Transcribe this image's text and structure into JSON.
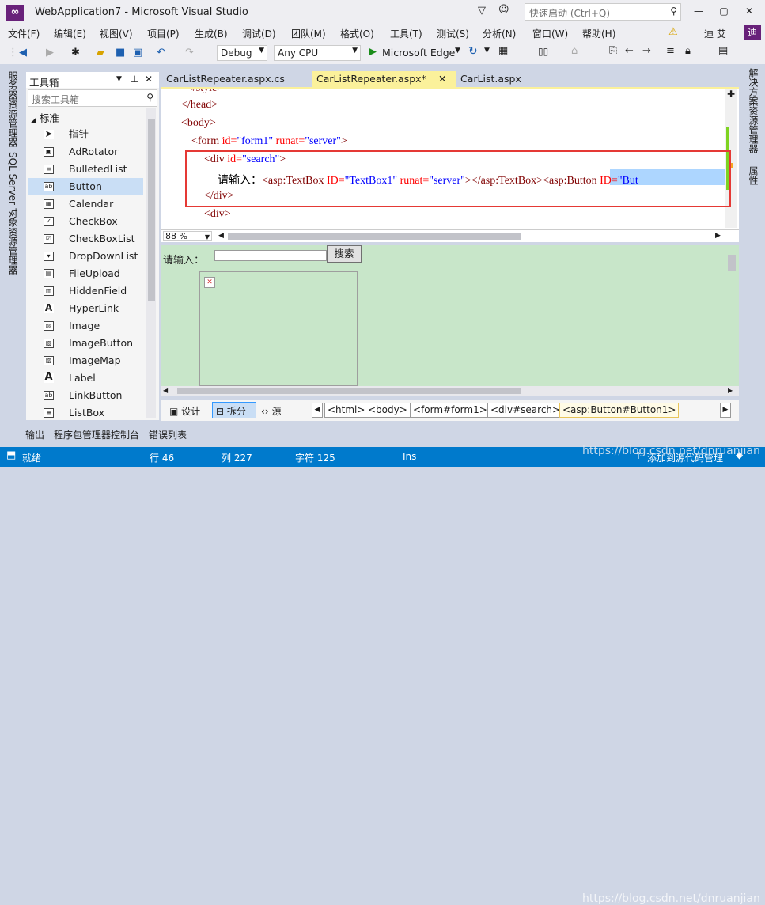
{
  "window": {
    "title": "WebApplication7 - Microsoft Visual Studio",
    "quick_launch_placeholder": "快速启动 (Ctrl+Q)",
    "logo": "vs-logo"
  },
  "menu": [
    "文件(F)",
    "编辑(E)",
    "视图(V)",
    "项目(P)",
    "生成(B)",
    "调试(D)",
    "团队(M)",
    "格式(O)",
    "工具(T)",
    "测试(S)",
    "分析(N)",
    "窗口(W)",
    "帮助(H)"
  ],
  "account": {
    "user": "迪 艾",
    "initial": "迪"
  },
  "toolbar": {
    "config": "Debug",
    "platform": "Any CPU",
    "browser": "Microsoft Edge"
  },
  "left_strip": {
    "server_explorer": "服务器资源管理器",
    "sql_explorer": "SQL Server 对象资源管理器"
  },
  "toolbox": {
    "title": "工具箱",
    "search_placeholder": "搜索工具箱",
    "group": "标准",
    "items": [
      "指针",
      "AdRotator",
      "BulletedList",
      "Button",
      "Calendar",
      "CheckBox",
      "CheckBoxList",
      "DropDownList",
      "FileUpload",
      "HiddenField",
      "HyperLink",
      "Image",
      "ImageButton",
      "ImageMap",
      "Label",
      "LinkButton",
      "ListBox"
    ],
    "selected": "Button"
  },
  "tabs": [
    {
      "label": "CarListRepeater.aspx.cs",
      "active": false
    },
    {
      "label": "CarListRepeater.aspx*",
      "active": true
    },
    {
      "label": "CarList.aspx",
      "active": false
    }
  ],
  "code": {
    "l0": "</style>",
    "l1": "</head>",
    "l2": "<body>",
    "l3_tag": "<form",
    "l3_id_attr": " id=",
    "l3_id_val": "\"form1\"",
    "l3_runat_attr": " runat=",
    "l3_runat_val": "\"server\"",
    "l3_end": ">",
    "l4_tag": "<div",
    "l4_attr": " id=",
    "l4_val": "\"search\"",
    "l4_end": ">",
    "l5_text": "请输入：",
    "l5_tb": "<asp:TextBox",
    "l5_id_attr": " ID=",
    "l5_id_val": "\"TextBox1\"",
    "l5_runat_attr": " runat=",
    "l5_runat_val": "\"server\"",
    "l5_close": "></asp:TextBox>",
    "l5_btn": "<asp:Button",
    "l5_btn_attr": " ID=",
    "l5_btn_val": "\"But",
    "l6": "</div>",
    "l7": "<div>"
  },
  "zoom": "88 %",
  "design": {
    "label": "请输入：",
    "button": "搜索"
  },
  "view_modes": [
    "设计",
    "拆分",
    "源"
  ],
  "breadcrumbs": [
    "<html>",
    "<body>",
    "<form#form1>",
    "<div#search>",
    "<asp:Button#Button1>"
  ],
  "right_strip": {
    "solution_explorer": "解决方案资源管理器",
    "properties": "属性"
  },
  "output_tabs": [
    "输出",
    "程序包管理器控制台",
    "错误列表"
  ],
  "status": {
    "ready": "就绪",
    "line": "行 46",
    "col": "列 227",
    "char": "字符 125",
    "mode": "Ins",
    "source_control": "添加到源代码管理",
    "watermark": "https://blog.csdn.net/dnruanjian"
  }
}
